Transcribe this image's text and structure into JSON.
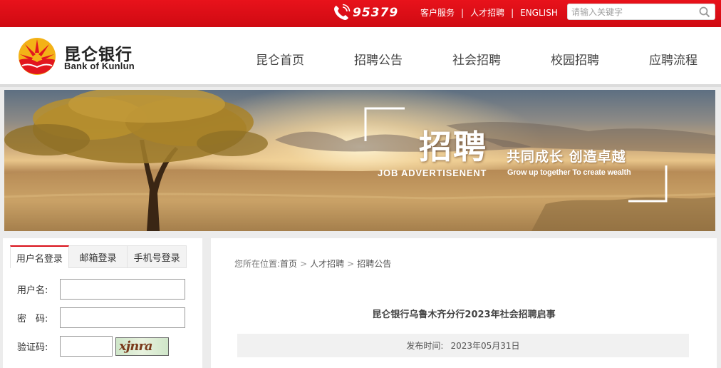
{
  "colors": {
    "brand_red": "#e8121b",
    "header_bg": "#ffffff",
    "page_bg": "#ececec"
  },
  "topbar": {
    "hotline": "95379",
    "links": [
      "客户服务",
      "人才招聘",
      "ENGLISH"
    ],
    "search_placeholder": "请输入关键字"
  },
  "header": {
    "brand_cn": "昆仑银行",
    "brand_en": "Bank of Kunlun",
    "nav": [
      "昆仑首页",
      "招聘公告",
      "社会招聘",
      "校园招聘",
      "应聘流程"
    ]
  },
  "banner": {
    "title": "招聘",
    "slogan_cn": "共同成长  创造卓越",
    "subtitle_en": "JOB  ADVERTISENENT",
    "slogan_en": "Grow up together To create wealth"
  },
  "login": {
    "tabs": [
      "用户名登录",
      "邮箱登录",
      "手机号登录"
    ],
    "username_label": "用户名:",
    "password_label": "密　码:",
    "captcha_label": "验证码:",
    "captcha_text": "xjnra"
  },
  "content": {
    "breadcrumb_prefix": "您所在位置:",
    "breadcrumb": [
      "首页",
      "人才招聘",
      "招聘公告"
    ],
    "article_title": "昆仑银行乌鲁木齐分行2023年社会招聘启事",
    "publish_label": "发布时间:",
    "publish_date": "2023年05月31日"
  }
}
